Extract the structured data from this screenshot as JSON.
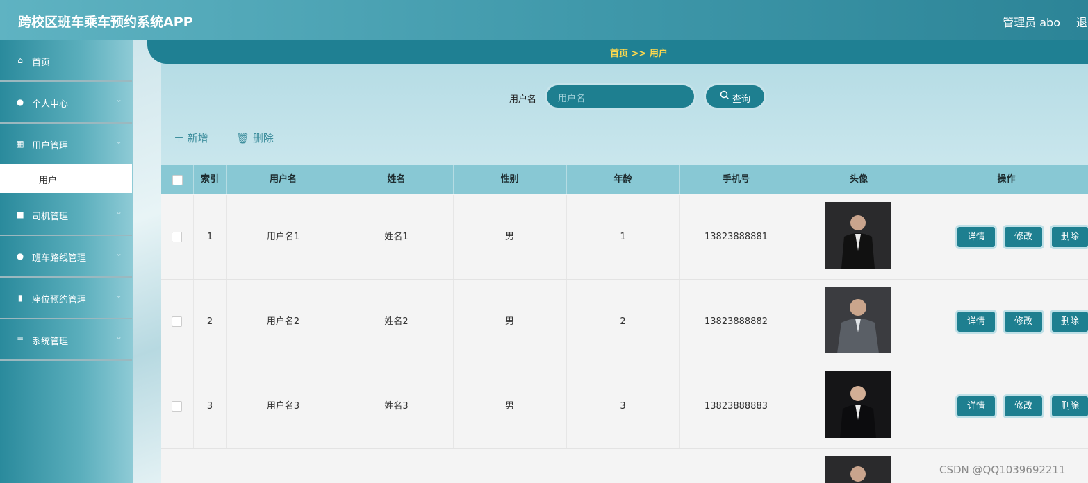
{
  "header": {
    "title": "跨校区班车乘车预约系统APP",
    "admin": "管理员 abo",
    "logout": "退"
  },
  "sidebar": {
    "items": [
      {
        "label": "首页",
        "icon": "home-icon"
      },
      {
        "label": "个人中心",
        "icon": "user-icon"
      },
      {
        "label": "用户管理",
        "icon": "grid-icon"
      },
      {
        "label": "司机管理",
        "icon": "briefcase-icon"
      },
      {
        "label": "班车路线管理",
        "icon": "bulb-icon"
      },
      {
        "label": "座位预约管理",
        "icon": "bar-chart-icon"
      },
      {
        "label": "系统管理",
        "icon": "list-icon"
      }
    ],
    "sub_item": "用户"
  },
  "breadcrumb": {
    "text": "首页 >> 用户"
  },
  "search": {
    "label": "用户名",
    "placeholder": "用户名",
    "button": "查询"
  },
  "actions": {
    "add": "新增",
    "delete": "删除"
  },
  "table": {
    "headers": [
      "索引",
      "用户名",
      "姓名",
      "性别",
      "年龄",
      "手机号",
      "头像",
      "操作"
    ],
    "rows": [
      {
        "index": "1",
        "username": "用户名1",
        "name": "姓名1",
        "gender": "男",
        "age": "1",
        "phone": "13823888881"
      },
      {
        "index": "2",
        "username": "用户名2",
        "name": "姓名2",
        "gender": "男",
        "age": "2",
        "phone": "13823888882"
      },
      {
        "index": "3",
        "username": "用户名3",
        "name": "姓名3",
        "gender": "男",
        "age": "3",
        "phone": "13823888883"
      }
    ],
    "buttons": {
      "detail": "详情",
      "edit": "修改",
      "delete": "删除"
    }
  },
  "watermark": "CSDN @QQ1039692211",
  "colors": {
    "accent": "#1e7f90",
    "header_bg": "#88c8d4",
    "breadcrumb_text": "#ffd94d"
  }
}
